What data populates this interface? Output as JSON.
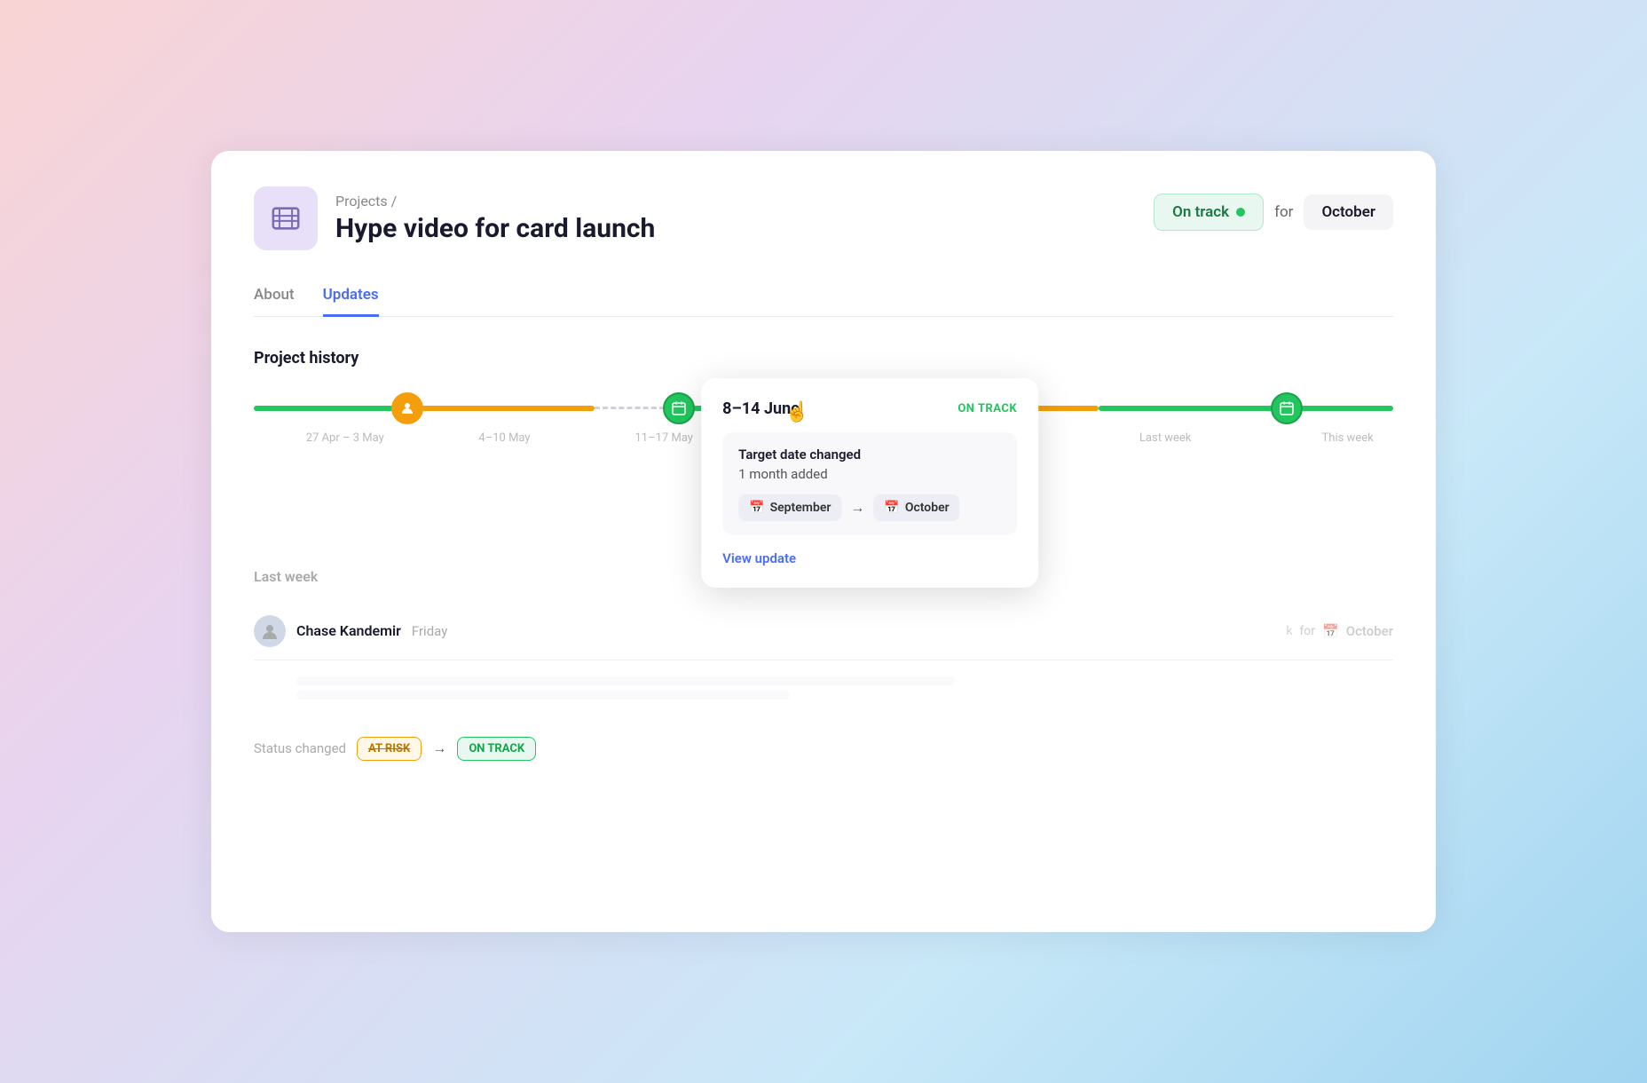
{
  "page": {
    "background": "gradient"
  },
  "breadcrumb": "Projects /",
  "project": {
    "title": "Hype video for card launch",
    "icon": "🎬"
  },
  "header": {
    "status_label": "On track",
    "status_dot_color": "#22c55e",
    "for_label": "for",
    "month_label": "October"
  },
  "tabs": [
    {
      "label": "About",
      "active": false
    },
    {
      "label": "Updates",
      "active": true
    }
  ],
  "section": {
    "title": "Project history"
  },
  "timeline": {
    "nodes": [
      {
        "type": "person",
        "label": "4–10 May"
      },
      {
        "type": "calendar",
        "label": "8–14 June"
      }
    ],
    "labels": [
      "27 Apr – 3 May",
      "4–10 May",
      "11–17 May",
      "Last week",
      "This week"
    ]
  },
  "tooltip": {
    "date_range": "8–14 June",
    "status": "ON TRACK",
    "change_title": "Target date changed",
    "change_subtitle": "1 month added",
    "from_month": "September",
    "to_month": "October",
    "link_label": "View update"
  },
  "last_week": {
    "label": "Last week",
    "update_user": "Chase Kandemir",
    "update_time": "Friday",
    "for_label": "for",
    "for_month": "October"
  },
  "status_change": {
    "label": "Status changed",
    "from": "AT RISK",
    "arrow": "→",
    "to": "ON TRACK"
  },
  "icons": {
    "calendar": "📅",
    "person": "👤",
    "arrow_right": "→",
    "film": "🎞️"
  }
}
